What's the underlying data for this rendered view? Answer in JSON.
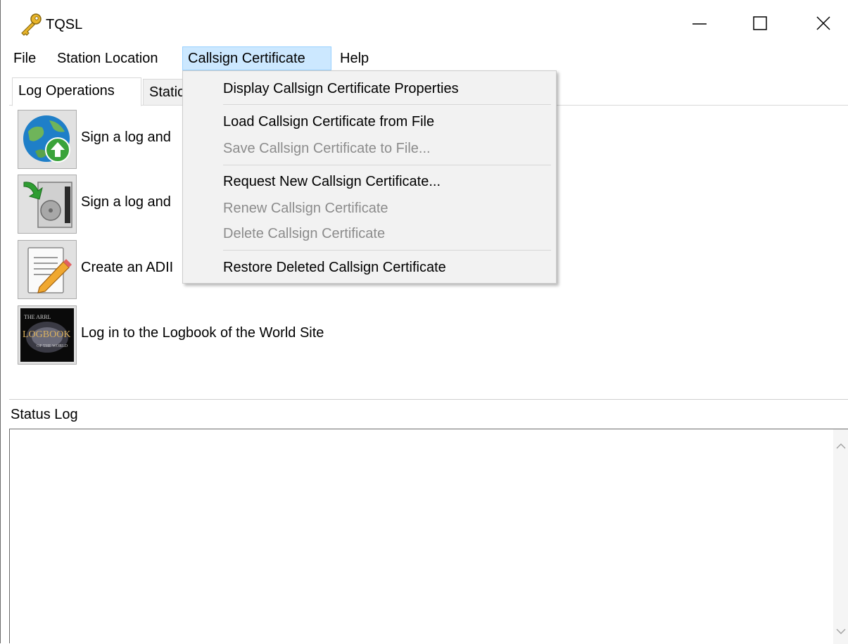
{
  "window": {
    "title": "TQSL",
    "controls": {
      "minimize": "minimize-icon",
      "maximize": "maximize-icon",
      "close": "close-icon"
    }
  },
  "menubar": {
    "file": "File",
    "station_location": "Station Location",
    "callsign_certificate": "Callsign Certificate",
    "help": "Help",
    "active_color": "#cce8ff"
  },
  "tabs": {
    "log_operations": "Log Operations",
    "station": "Statio"
  },
  "operations": [
    {
      "label": "Sign a log and",
      "icon": "globe-upload-icon"
    },
    {
      "label": "Sign a log and",
      "icon": "save-disk-icon"
    },
    {
      "label": "Create an ADII",
      "icon": "edit-document-icon"
    },
    {
      "label": "Log in to the Logbook of the World Site",
      "icon": "logbook-logo-icon"
    }
  ],
  "status": {
    "title": "Status Log",
    "log_text": ""
  },
  "dropdown": {
    "items": [
      {
        "label": "Display Callsign Certificate Properties",
        "enabled": true
      },
      {
        "label": "Load Callsign Certificate from File",
        "enabled": true
      },
      {
        "label": "Save Callsign Certificate to File...",
        "enabled": false
      },
      {
        "label": "Request New Callsign Certificate...",
        "enabled": true
      },
      {
        "label": "Renew Callsign Certificate",
        "enabled": false
      },
      {
        "label": "Delete Callsign Certificate",
        "enabled": false
      },
      {
        "label": "Restore Deleted Callsign Certificate",
        "enabled": true
      }
    ],
    "disabled_color": "#8c8c8c"
  }
}
